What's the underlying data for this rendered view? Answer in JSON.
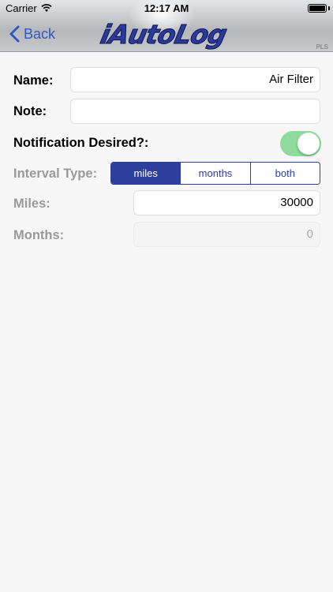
{
  "status_bar": {
    "carrier": "Carrier",
    "time": "12:17 AM"
  },
  "nav": {
    "back_label": "Back",
    "logo_text": "iAutoLog",
    "logo_badge": "PLS"
  },
  "form": {
    "name": {
      "label": "Name:",
      "value": "Air Filter"
    },
    "note": {
      "label": "Note:",
      "value": ""
    },
    "notification": {
      "label": "Notification Desired?:",
      "enabled": true
    },
    "interval_type": {
      "label": "Interval Type:",
      "options": [
        "miles",
        "months",
        "both"
      ],
      "selected": "miles"
    },
    "miles": {
      "label": "Miles:",
      "value": "30000"
    },
    "months": {
      "label": "Months:",
      "value": "0"
    }
  },
  "colors": {
    "accent": "#2d3f9e",
    "back_link": "#2d58c7",
    "toggle_on": "#8fdb9d"
  }
}
